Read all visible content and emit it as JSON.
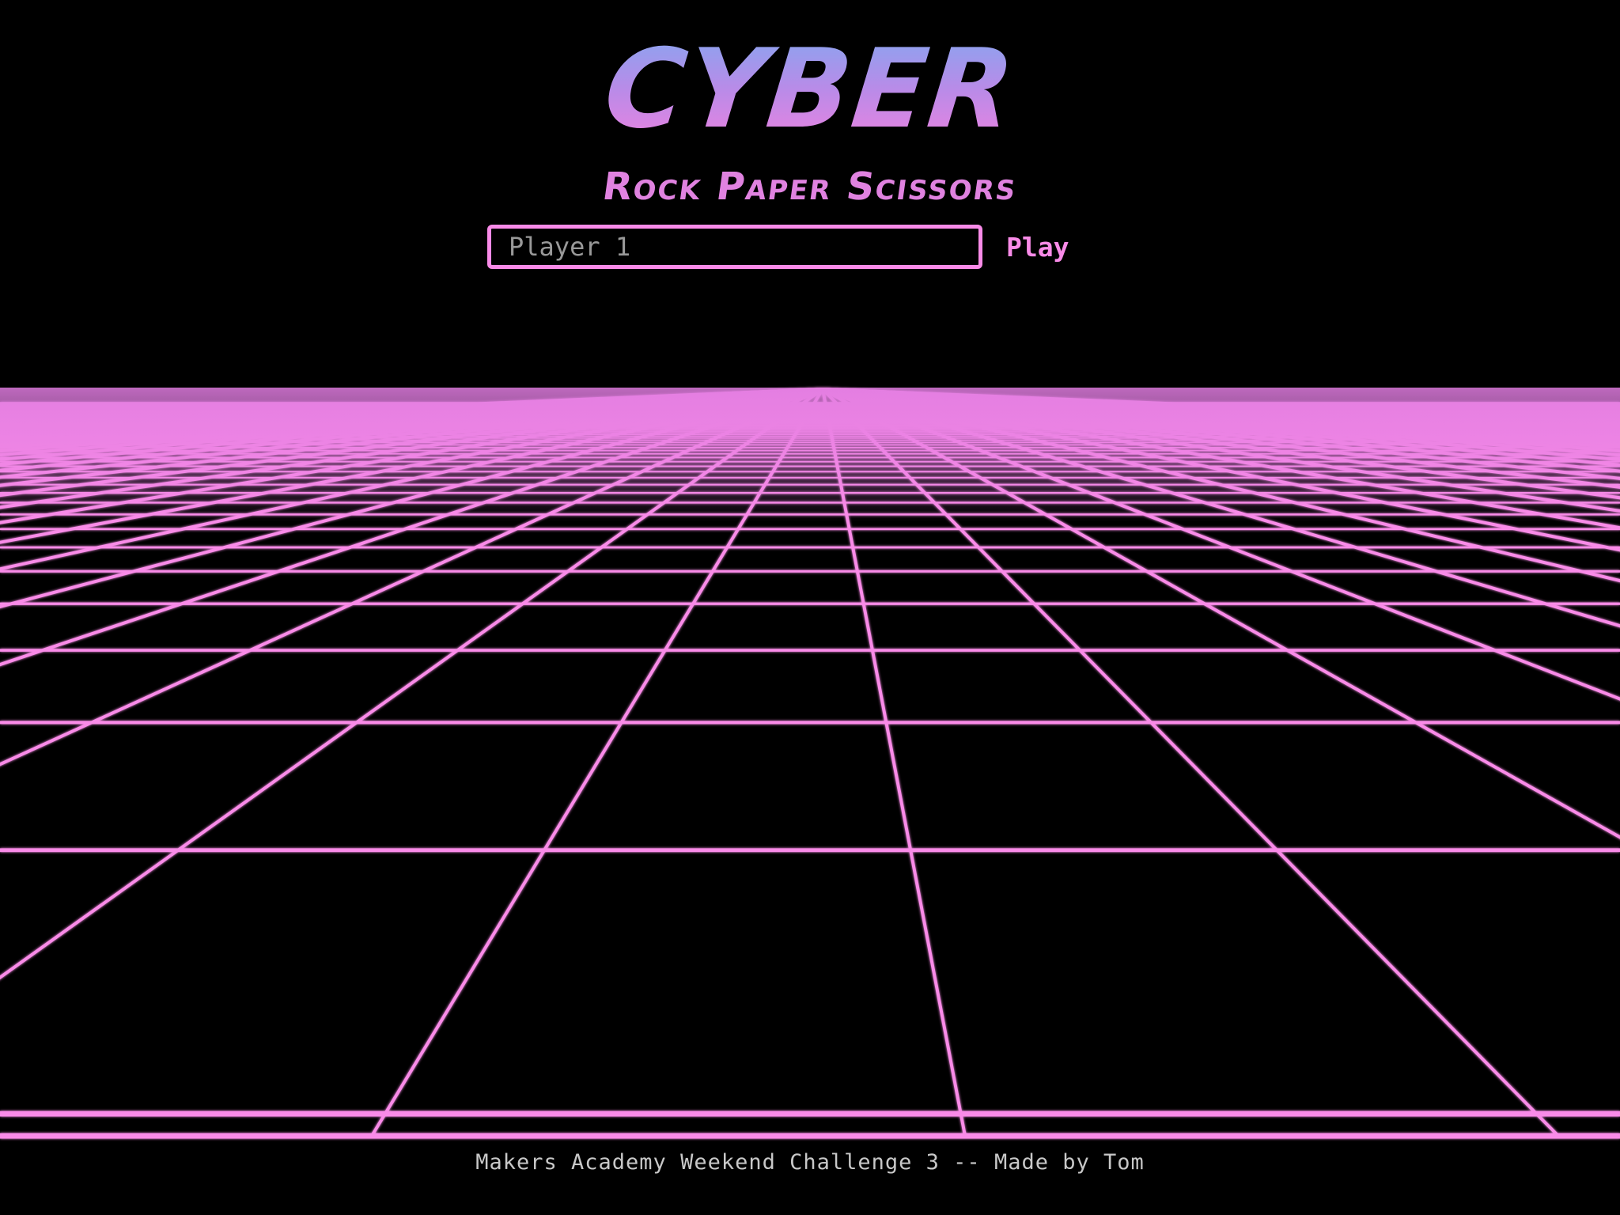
{
  "header": {
    "title": "CYBER",
    "subtitle": "Rock Paper Scissors"
  },
  "form": {
    "name_input": {
      "value": "",
      "placeholder": "Player 1"
    },
    "play_label": "Play"
  },
  "footer": {
    "text": "Makers Academy Weekend Challenge 3 -- Made by Tom"
  },
  "theme": {
    "background": "#000000",
    "grid_color": "#f98be8",
    "accent": "#f98be8",
    "subtitle_color": "#e082e0",
    "title_gradient": [
      "#86a6f0",
      "#ee82e0"
    ],
    "footer_color": "#c8c8c8",
    "placeholder_color": "#999999"
  },
  "background": {
    "icon": "perspective-grid-floor"
  }
}
